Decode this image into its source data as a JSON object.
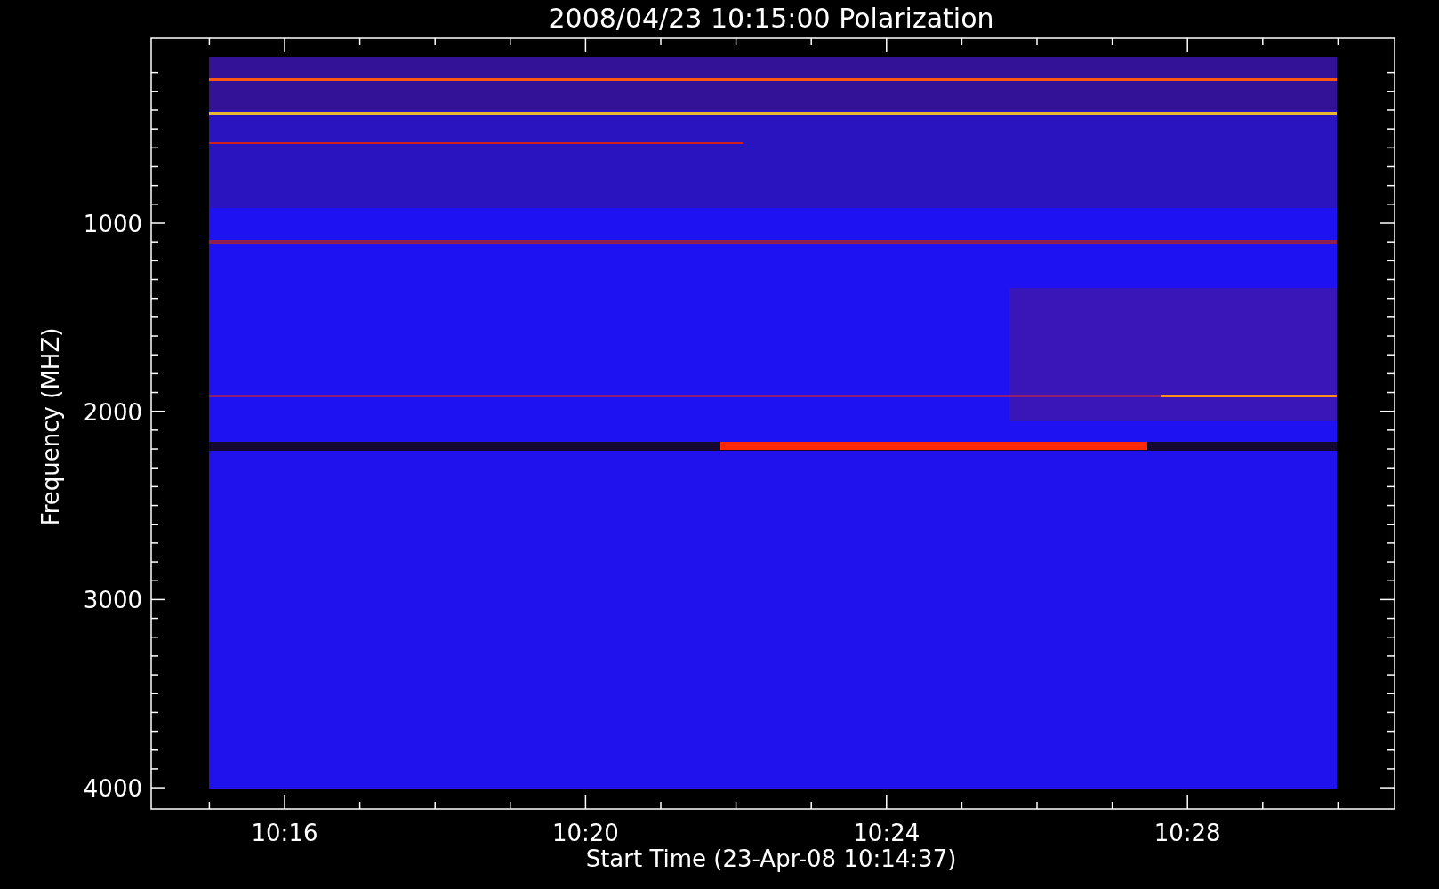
{
  "title": "2008/04/23 10:15:00 Polarization",
  "y_axis": {
    "label": "Frequency (MHZ)",
    "tick_labels": [
      "1000",
      "2000",
      "3000",
      "4000"
    ]
  },
  "x_axis": {
    "label": "Start Time (23-Apr-08 10:14:37)",
    "tick_labels": [
      "10:16",
      "10:20",
      "10:24",
      "10:28"
    ]
  }
}
